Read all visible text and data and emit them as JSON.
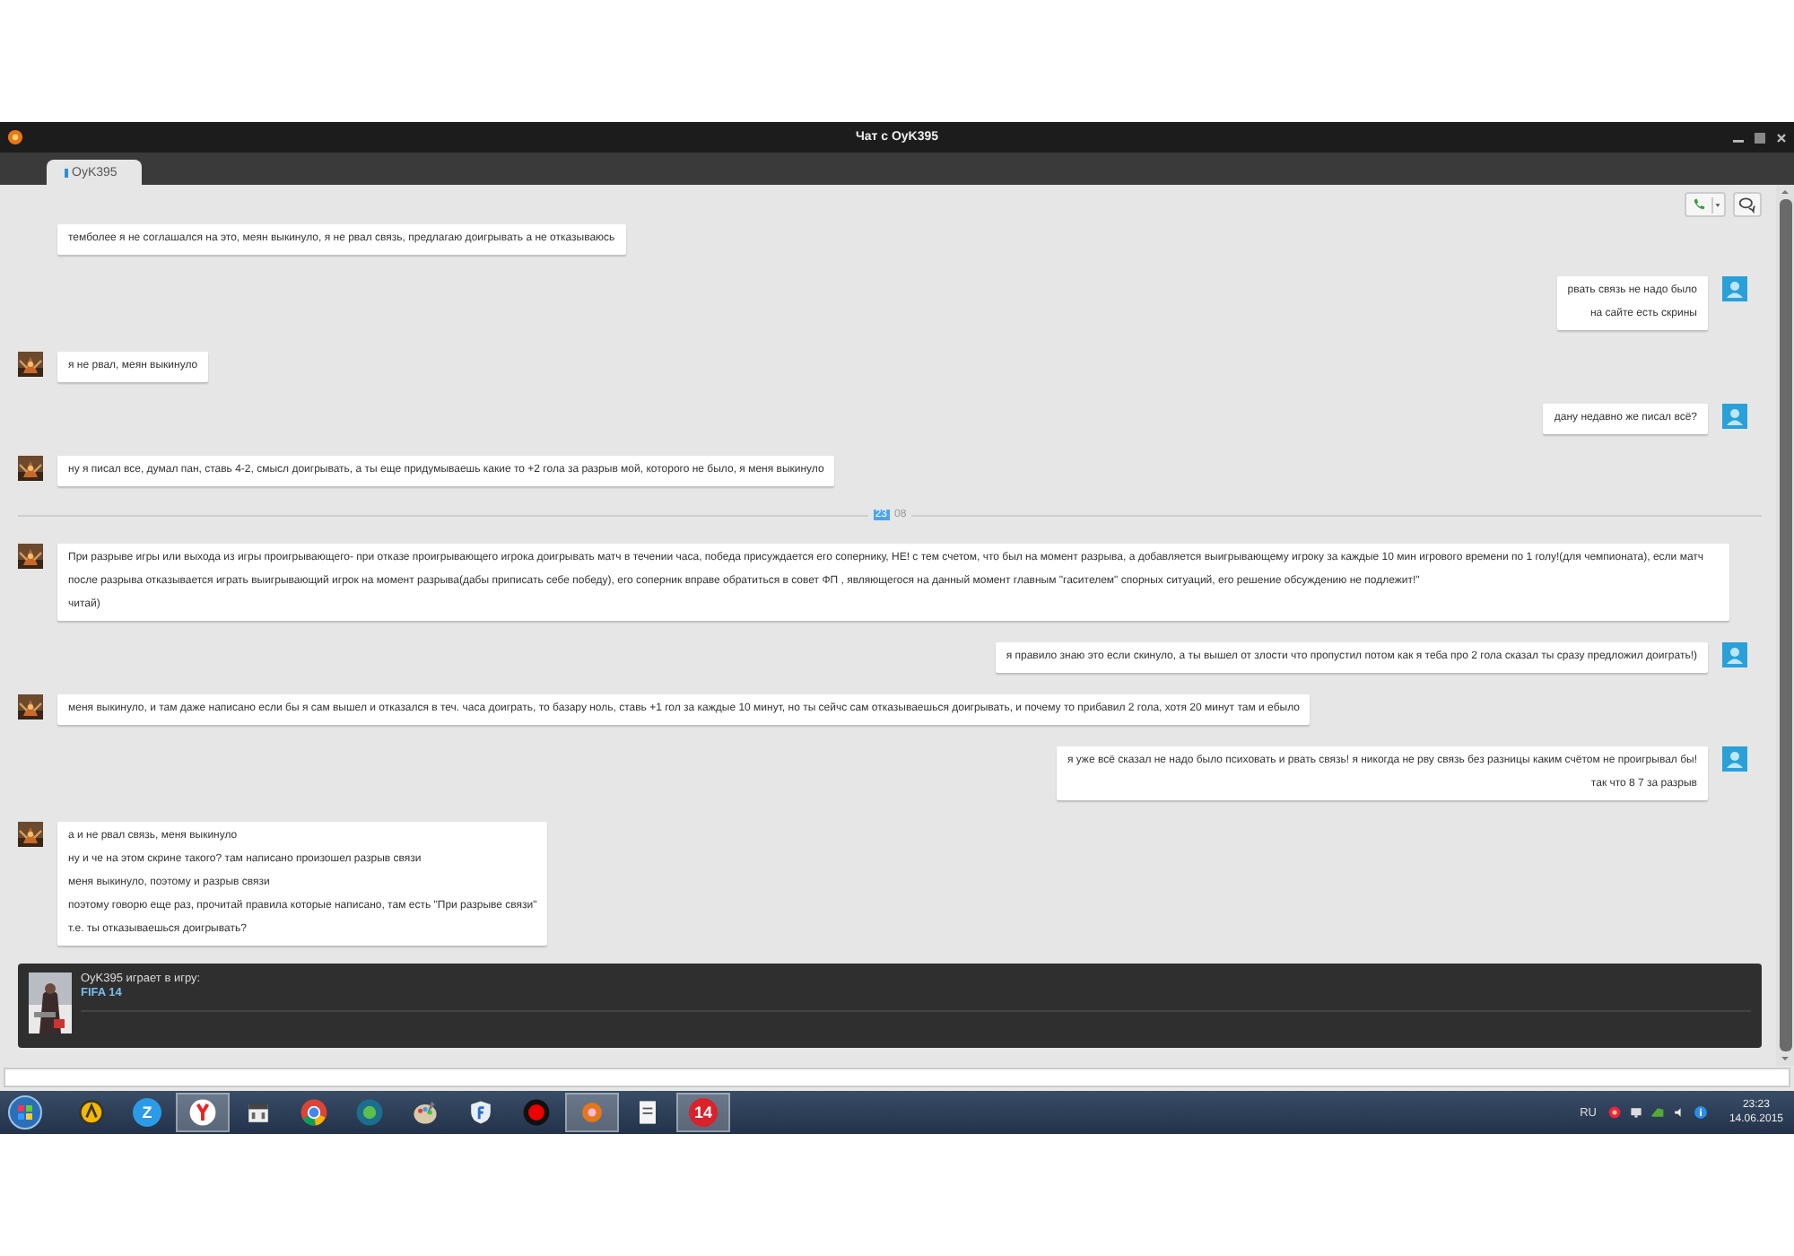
{
  "window": {
    "title": "Чат с OyK395"
  },
  "tabs": [
    {
      "label": "OyK395",
      "selected": true,
      "color": "#2a8fd6"
    }
  ],
  "messages": [
    {
      "kind": "in",
      "avatar": false,
      "lines": [
        "темболее я не соглашался на это, меян выкинуло, я не рвал связь, предлагаю доигрывать а не отказываюсь"
      ]
    },
    {
      "kind": "out",
      "avatar": true,
      "lines": [
        "рвать связь не надо было",
        "на сайте есть скрины"
      ]
    },
    {
      "kind": "in",
      "avatar": true,
      "lines": [
        "я не рвал, меян выкинуло"
      ]
    },
    {
      "kind": "out",
      "avatar": true,
      "lines": [
        "дану недавно же писал всё?"
      ]
    },
    {
      "kind": "in",
      "avatar": true,
      "lines": [
        "ну я писал все, думал пан, ставь 4-2, смысл доигрывать, а ты еще придумываешь какие то +2 гола за разрыв мой, которого не было, я меня выкинуло"
      ]
    },
    {
      "kind": "divider",
      "time_highlight": "23",
      "time_rest": "08"
    },
    {
      "kind": "in",
      "avatar": true,
      "lines": [
        "При разрыве игры или выхода из игры проигрывающего- при отказе проигрывающего игрока доигрывать матч в течении часа, победа присуждается его сопернику, НЕ! с тем счетом, что был на момент разрыва, а добавляется выигрывающему игроку за каждые 10 мин игрового времени по 1 голу!(для чемпионата), если матч после разрыва отказывается играть выигрывающий игрок на момент разрыва(дабы приписать себе победу), его соперник вправе обратиться в совет ФП , являющегося на данный момент главным \"гасителем\" спорных ситуаций, его решение обсуждению не подлежит!\"",
        "читай)"
      ]
    },
    {
      "kind": "out",
      "avatar": true,
      "lines": [
        "я правило знаю это если скинуло, а ты вышел от злости что пропустил потом как я теба про 2 гола сказал ты сразу предложил доиграть!)"
      ]
    },
    {
      "kind": "in",
      "avatar": true,
      "lines": [
        "меня выкинуло, и там даже написано если бы я сам вышел и отказался в теч. часа доиграть, то базару ноль, ставь +1 гол за каждые 10 минут, но ты сейчс сам отказываешься доигрывать, и почему то прибавил 2 гола, хотя 20 минут там и ебыло"
      ]
    },
    {
      "kind": "out",
      "avatar": true,
      "lines": [
        "я уже всё сказал не надо было психовать и рвать связь! я никогда не рву связь без разницы каким счётом не проигрывал бы!",
        "так что 8 7 за разрыв"
      ]
    },
    {
      "kind": "in",
      "avatar": true,
      "lines": [
        "а  и не рвал связь, меня выкинуло",
        "ну и че на этом скрине такого? там написано произошел разрыв связи",
        "меня выкинуло, поэтому и разрыв связи",
        "поэтому говорю еще раз, прочитай правила которые написано, там есть \"При разрыве связи\"",
        "т.е. ты отказываешься доигрывать?"
      ]
    }
  ],
  "game": {
    "status": "OyK395 играет в игру:",
    "title": "FIFA 14"
  },
  "taskbar": {
    "apps": [
      {
        "kind": "amigo"
      },
      {
        "kind": "letter",
        "label": "Z"
      },
      {
        "kind": "yandex"
      },
      {
        "kind": "calendar"
      },
      {
        "kind": "chrome"
      },
      {
        "kind": "globe"
      },
      {
        "kind": "paint"
      },
      {
        "kind": "shield"
      },
      {
        "kind": "record"
      },
      {
        "kind": "app"
      },
      {
        "kind": "doc"
      },
      {
        "kind": "badge",
        "label": "14"
      }
    ],
    "language": "RU",
    "time": "23:23",
    "date": "14.06.2015"
  }
}
